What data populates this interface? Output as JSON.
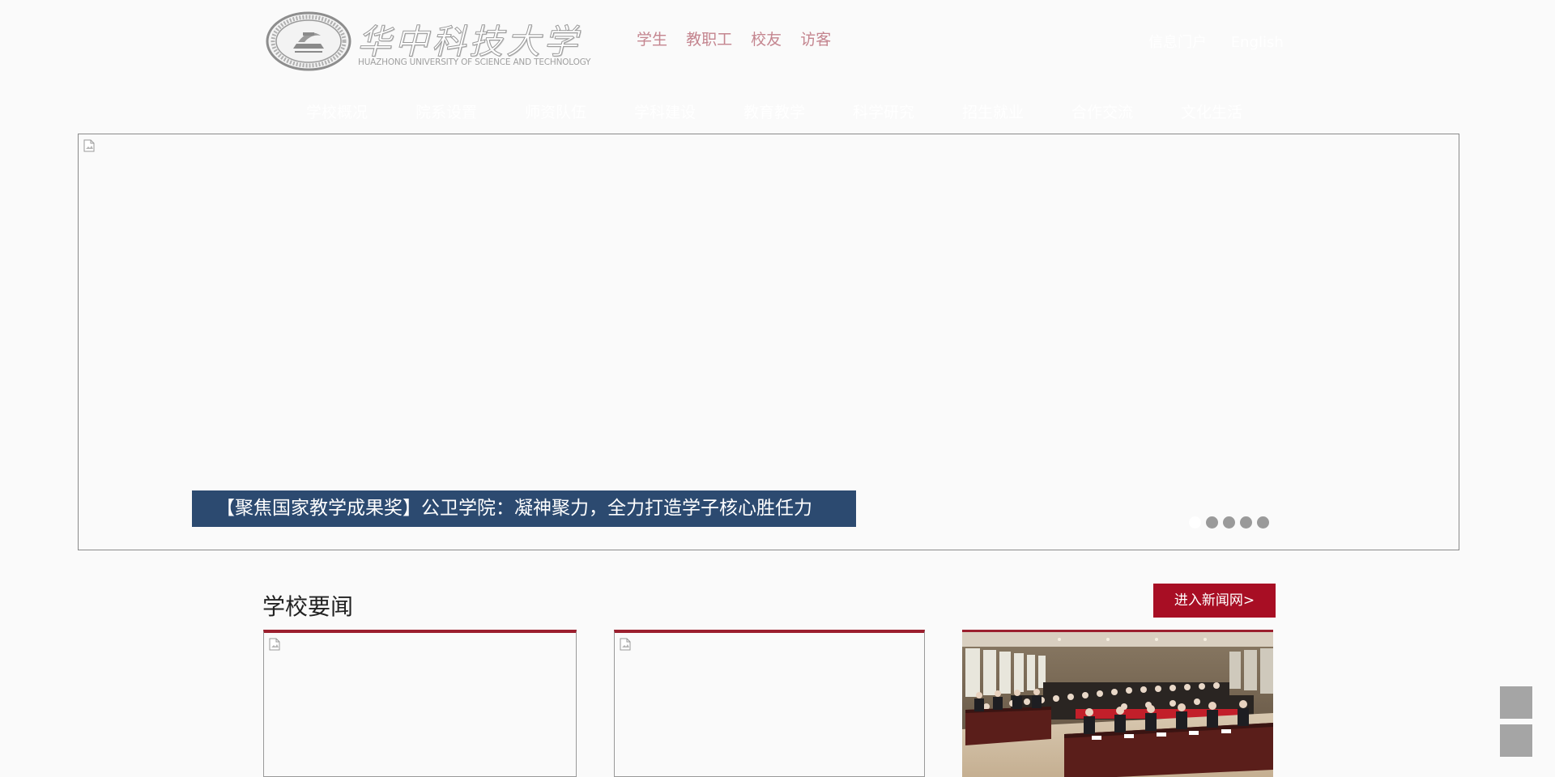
{
  "header": {
    "logo": {
      "title": "华中科技大学",
      "subtitle": "HUAZHONG UNIVERSITY OF SCIENCE AND TECHNOLOGY"
    },
    "quick_links": [
      "学生",
      "教职工",
      "校友",
      "访客"
    ],
    "utility_links": [
      "信息门户",
      "English"
    ]
  },
  "nav": {
    "items": [
      "学校概况",
      "院系设置",
      "师资队伍",
      "学科建设",
      "教育教学",
      "科学研究",
      "招生就业",
      "合作交流",
      "文化生活"
    ]
  },
  "hero": {
    "caption": "【聚焦国家教学成果奖】公卫学院：凝神聚力，全力打造学子核心胜任力",
    "slide_count": 5,
    "active_slide": 1
  },
  "news": {
    "title": "学校要闻",
    "more_button": "进入新闻网>"
  },
  "colors": {
    "accent_red": "#a80e24",
    "caption_blue": "#2c4a70",
    "quick_link_pink": "#c4858f"
  },
  "icons": [
    "broken-image-icon",
    "logo-seal-icon"
  ]
}
